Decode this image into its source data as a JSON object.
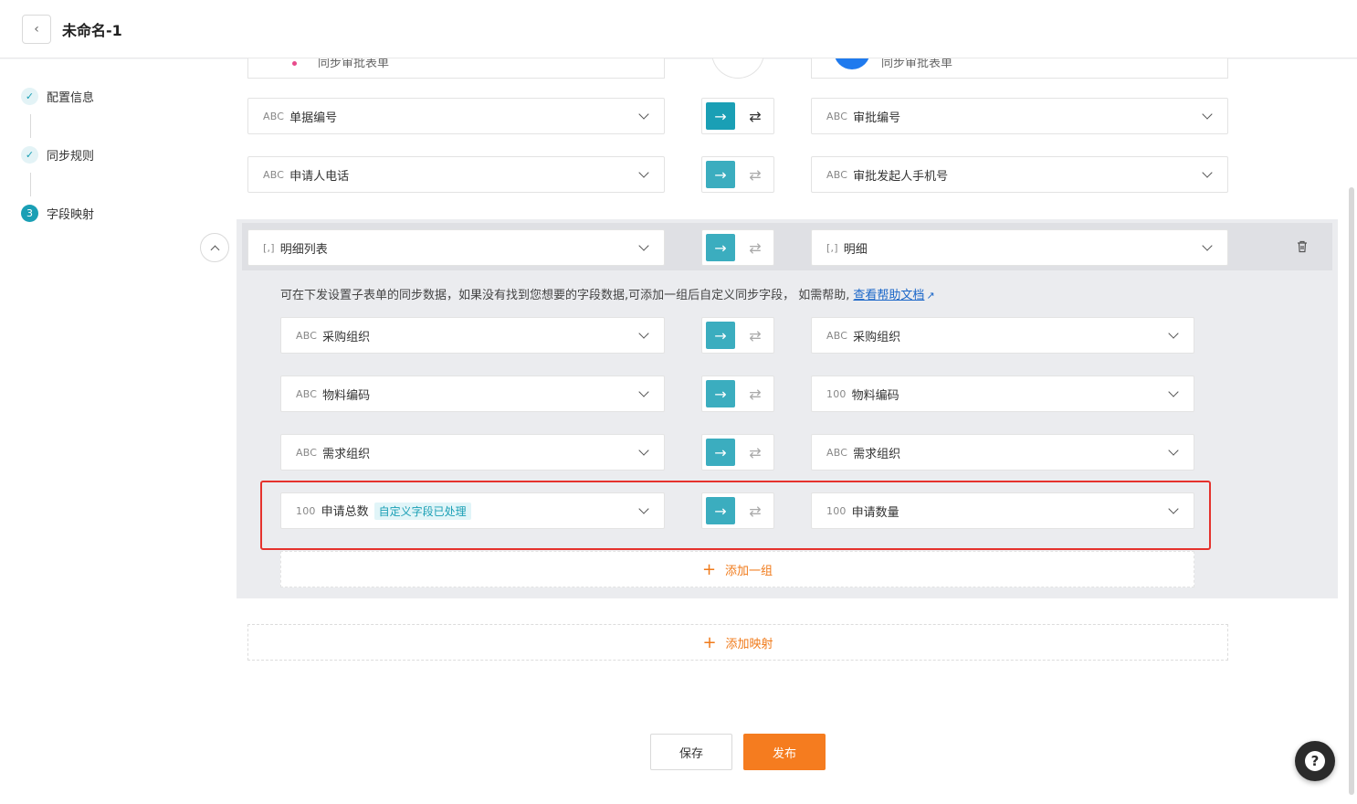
{
  "header": {
    "title": "未命名-1"
  },
  "sidebar": {
    "steps": [
      {
        "label": "配置信息",
        "state": "done"
      },
      {
        "label": "同步规则",
        "state": "done"
      },
      {
        "label": "字段映射",
        "state": "active",
        "number": "3"
      }
    ]
  },
  "top_cards": {
    "left_label": "同步审批表单",
    "right_label": "同步审批表单"
  },
  "mappings": [
    {
      "left_type": "ABC",
      "left_field": "单据编号",
      "right_type": "ABC",
      "right_field": "审批编号"
    },
    {
      "left_type": "ABC",
      "left_field": "申请人电话",
      "right_type": "ABC",
      "right_field": "审批发起人手机号"
    }
  ],
  "group": {
    "left_type": "[,]",
    "left_field": "明细列表",
    "right_type": "[,]",
    "right_field": "明细",
    "hint": "可在下发设置子表单的同步数据，如果没有找到您想要的字段数据,可添加一组后自定义同步字段， 如需帮助,",
    "help_link": "查看帮助文档",
    "rows": [
      {
        "left_type": "ABC",
        "left_field": "采购组织",
        "right_type": "ABC",
        "right_field": "采购组织"
      },
      {
        "left_type": "ABC",
        "left_field": "物料编码",
        "right_type": "100",
        "right_field": "物料编码"
      },
      {
        "left_type": "ABC",
        "left_field": "需求组织",
        "right_type": "ABC",
        "right_field": "需求组织"
      },
      {
        "left_type": "100",
        "left_field": "申请总数",
        "left_tag": "自定义字段已处理",
        "right_type": "100",
        "right_field": "申请数量"
      }
    ],
    "add_group_label": "添加一组"
  },
  "add_mapping_label": "添加映射",
  "buttons": {
    "save": "保存",
    "publish": "发布"
  },
  "colors": {
    "accent": "#1a9fb5",
    "orange": "#f57c1f",
    "highlight_border": "#e5322d",
    "link": "#1a66c8"
  }
}
